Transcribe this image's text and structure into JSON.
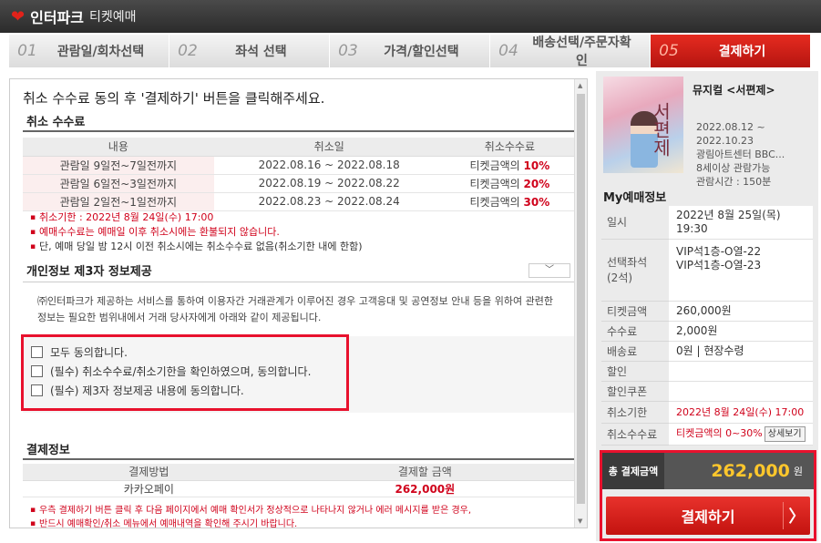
{
  "header": {
    "brand": "인터파크",
    "sub": "티켓예매"
  },
  "steps": [
    {
      "num": "01",
      "label": "관람일/회차선택"
    },
    {
      "num": "02",
      "label": "좌석 선택"
    },
    {
      "num": "03",
      "label": "가격/할인선택"
    },
    {
      "num": "04",
      "label": "배송선택/주문자확인"
    },
    {
      "num": "05",
      "label": "결제하기"
    }
  ],
  "main": {
    "intro": "취소 수수료 동의 후 '결제하기' 버튼을 클릭해주세요.",
    "fee_title": "취소 수수료",
    "fee_headers": [
      "내용",
      "취소일",
      "취소수수료"
    ],
    "fee_rows": [
      {
        "content": "관람일 9일전~7일전까지",
        "date": "2022.08.16 ~ 2022.08.18",
        "fee_prefix": "티켓금액의",
        "fee_rate": "10%"
      },
      {
        "content": "관람일 6일전~3일전까지",
        "date": "2022.08.19 ~ 2022.08.22",
        "fee_prefix": "티켓금액의",
        "fee_rate": "20%"
      },
      {
        "content": "관람일 2일전~1일전까지",
        "date": "2022.08.23 ~ 2022.08.24",
        "fee_prefix": "티켓금액의",
        "fee_rate": "30%"
      }
    ],
    "notes": [
      "취소기한 : 2022년 8월 24일(수) 17:00",
      "예매수수료는 예매일 이후 취소시에는 환불되지 않습니다.",
      "단, 예매 당일 밤 12시 이전 취소시에는 취소수수료 없음(취소기한 내에 한함)"
    ],
    "privacy_title": "개인정보 제3자 정보제공",
    "privacy_text": "㈜인터파크가 제공하는 서비스를 통하여 이용자간 거래관계가 이루어진 경우 고객응대 및 공연정보 안내 등을 위하여 관련한 정보는 필요한 범위내에서 거래 당사자에게 아래와 같이 제공됩니다.",
    "agreements": [
      "모두 동의합니다.",
      "(필수) 취소수수료/취소기한을 확인하였으며, 동의합니다.",
      "(필수) 제3자 정보제공 내용에 동의합니다."
    ],
    "payment_title": "결제정보",
    "payment_headers": [
      "결제방법",
      "결제할 금액"
    ],
    "payment_method": "카카오페이",
    "payment_amount": "262,000원",
    "payment_notes": [
      "우측 결제하기 버튼 클릭 후 다음 페이지에서 예매 확인서가 정상적으로 나타나지 않거나 에러 메시지를 받은 경우,",
      "반드시 예매확인/취소 메뉴에서 예매내역을 확인해 주시기 바랍니다."
    ]
  },
  "sidebar": {
    "show_title": "뮤지컬 <서편제>",
    "poster_text": "서편제",
    "show_info": [
      "2022.08.12 ~",
      "2022.10.23",
      "광림아트센터 BBC...",
      "8세이상 관람가능",
      "관람시간 : 150분"
    ],
    "my_title": "My예매정보",
    "rows": [
      {
        "label": "일시",
        "value": "2022년 8월 25일(목)\n19:30"
      },
      {
        "label": "선택좌석\n(2석)",
        "value": "VIP석1층-O열-22\nVIP석1층-O열-23"
      },
      {
        "label": "티켓금액",
        "value": "260,000원"
      },
      {
        "label": "수수료",
        "value": "2,000원"
      },
      {
        "label": "배송료",
        "value": "0원 | 현장수령"
      },
      {
        "label": "할인",
        "value": ""
      },
      {
        "label": "할인쿠폰",
        "value": ""
      },
      {
        "label": "취소기한",
        "value": "2022년 8월 24일(수) 17:00"
      },
      {
        "label": "취소수수료",
        "value": "티켓금액의 0~30%"
      }
    ],
    "detail_button": "상세보기",
    "total_label": "총 결제금액",
    "total_amount": "262,000",
    "total_unit": "원",
    "pay_button": "결제하기"
  },
  "colors": {
    "accent": "#e62b20",
    "highlight_border": "#e8112d",
    "total_amount": "#ffc72c"
  }
}
